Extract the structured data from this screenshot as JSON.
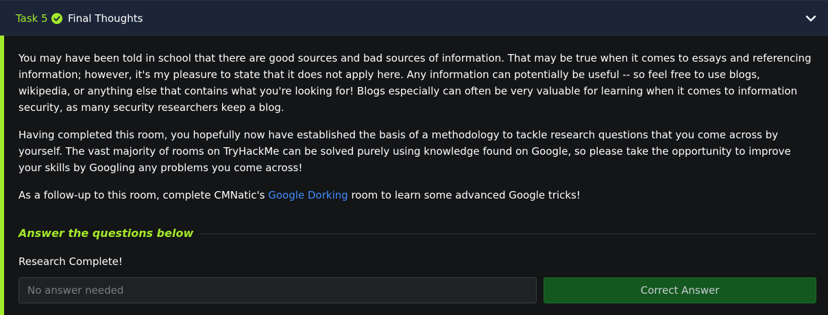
{
  "task": {
    "number_label": "Task 5",
    "title": "Final Thoughts"
  },
  "content": {
    "paragraph1": "You may have been told in school that there are good sources and bad sources of information. That may be true when it comes to essays and referencing information; however, it's my pleasure to state that it does not apply here. Any information can potentially be useful -- so feel free to use blogs, wikipedia, or anything else that contains what you're looking for! Blogs especially can often be very valuable for learning when it comes to information security, as many security researchers keep a blog.",
    "paragraph2": "Having completed this room, you hopefully now have established the basis of a methodology to tackle research questions that you come across by yourself. The vast majority of rooms on TryHackMe can be solved purely using knowledge found on Google, so please take the opportunity to improve your skills by Googling any problems you come across!",
    "paragraph3_before": "As a follow-up to this room, complete CMNatic's ",
    "paragraph3_link": "Google Dorking",
    "paragraph3_after": " room to learn some advanced Google tricks!"
  },
  "answers": {
    "heading": "Answer the questions below",
    "question": "Research Complete!",
    "input_placeholder": "No answer needed",
    "button_label": "Correct Answer"
  },
  "colors": {
    "accent": "#a3ea2a",
    "link": "#3f8eff",
    "header_bg": "#1c2538",
    "correct_bg": "#14581f"
  },
  "icons": {
    "task_status": "check-circle-icon",
    "collapse": "chevron-down-icon"
  }
}
